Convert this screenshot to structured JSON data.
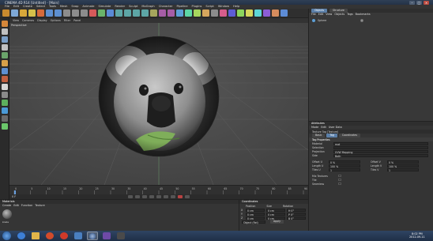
{
  "window": {
    "title": "CINEMA 4D R14 [Untitled] - [Main]"
  },
  "menu": {
    "items": [
      "File",
      "Edit",
      "Create",
      "Select",
      "Tools",
      "Mesh",
      "Snap",
      "Animate",
      "Simulate",
      "Render",
      "Sculpt",
      "MoGraph",
      "Character",
      "Pipeline",
      "Plugins",
      "Script",
      "Window",
      "Help"
    ]
  },
  "viewport": {
    "menu": [
      "View",
      "Cameras",
      "Display",
      "Options",
      "Filter",
      "Panel"
    ],
    "label": "Perspective"
  },
  "timeline": {
    "ticks": [
      "0",
      "5",
      "10",
      "15",
      "20",
      "25",
      "30",
      "35",
      "40",
      "45",
      "50",
      "55",
      "60",
      "65",
      "70",
      "75",
      "80",
      "85",
      "90"
    ],
    "frame_readout": "0 F"
  },
  "materials": {
    "menu": [
      "Create",
      "Edit",
      "Function",
      "Texture"
    ],
    "title": "Materials",
    "thumb_label": "koala"
  },
  "coords": {
    "title": "Coordinates",
    "headers": [
      "Position",
      "Size",
      "Rotation"
    ],
    "rows": [
      {
        "axis": "X",
        "pos": "0 cm",
        "size": "0 cm",
        "rot": "H 0°"
      },
      {
        "axis": "Y",
        "pos": "0 cm",
        "size": "0 cm",
        "rot": "P 0°"
      },
      {
        "axis": "Z",
        "pos": "0 cm",
        "size": "0 cm",
        "rot": "B 0°"
      }
    ],
    "mode": "Object (Rel)",
    "apply": "Apply"
  },
  "objects": {
    "tabs": [
      "Objects",
      "Structure"
    ],
    "menu": [
      "File",
      "Edit",
      "View",
      "Objects",
      "Tags",
      "Bookmarks"
    ],
    "items": [
      {
        "name": "Sphere"
      }
    ]
  },
  "attributes": {
    "title": "Attributes",
    "menu": [
      "Mode",
      "Edit",
      "User Data"
    ],
    "header": "Texture Tag [Texture]",
    "tabs": [
      "Basic",
      "Tag",
      "Coordinates"
    ],
    "section": "Tag Properties",
    "props": [
      {
        "label": "Material",
        "value": "mat"
      },
      {
        "label": "Selection",
        "value": ""
      },
      {
        "label": "Projection",
        "value": "UVW Mapping"
      },
      {
        "label": "Side",
        "value": "Both"
      }
    ],
    "offsets": [
      {
        "label": "Offset U",
        "value": "0 %",
        "label2": "Offset V",
        "value2": "0 %"
      },
      {
        "label": "Length U",
        "value": "100 %",
        "label2": "Length V",
        "value2": "100 %"
      },
      {
        "label": "Tiles U",
        "value": "1",
        "label2": "Tiles V",
        "value2": "1"
      }
    ],
    "checks": [
      {
        "label": "Mix Textures"
      },
      {
        "label": "Tile"
      },
      {
        "label": "Seamless"
      }
    ]
  },
  "taskbar": {
    "clock_time": "8:02 PM",
    "clock_date": "2012-09-11"
  },
  "colors": {
    "accent": "#5b7fa8",
    "grid": "#5a5a5a"
  }
}
